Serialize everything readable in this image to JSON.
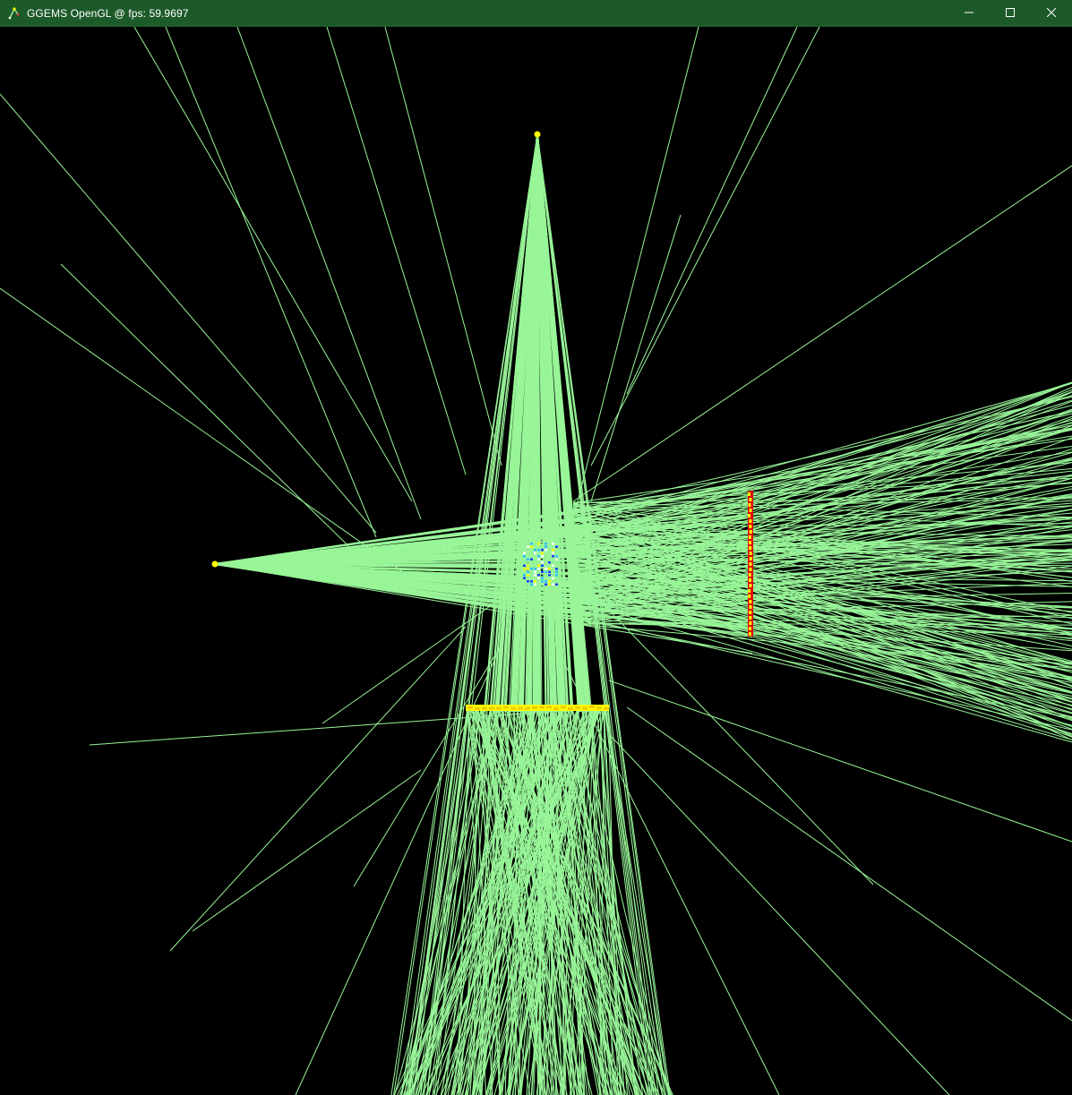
{
  "window": {
    "title": "GGEMS OpenGL @ fps: 59.9697",
    "controls": {
      "minimize_icon": "minimize-icon",
      "maximize_icon": "maximize-icon",
      "close_icon": "close-icon"
    }
  },
  "scene": {
    "background": "#000000",
    "ray_color": "#98f598",
    "source_color": "#ffff00",
    "detector_hit_color": "#ffff00",
    "detector_body_color": "#e00000",
    "phantom_colors": [
      "#ffffff",
      "#2040ff",
      "#ffff00",
      "#30c0ff"
    ],
    "sources": [
      {
        "name": "top-source"
      },
      {
        "name": "left-source"
      }
    ],
    "detectors": [
      {
        "name": "right-detector",
        "orientation": "vertical"
      },
      {
        "name": "bottom-detector",
        "orientation": "horizontal"
      }
    ]
  }
}
